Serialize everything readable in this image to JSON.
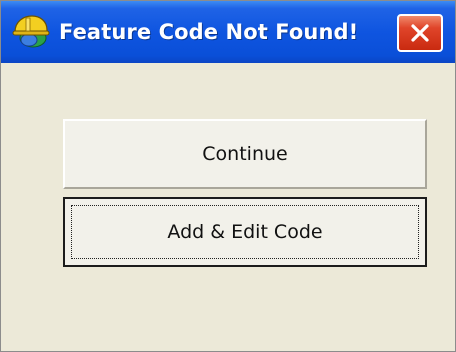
{
  "window": {
    "title": "Feature Code Not Found!",
    "app_icon": "surveyor-hardhat-icon",
    "close_icon": "close-icon"
  },
  "buttons": {
    "continue_label": "Continue",
    "add_edit_label": "Add & Edit Code"
  },
  "colors": {
    "titlebar": "#0f55e0",
    "close_button": "#d9381f",
    "dialog_background": "#ece9d8",
    "button_face": "#f2f1ea"
  }
}
